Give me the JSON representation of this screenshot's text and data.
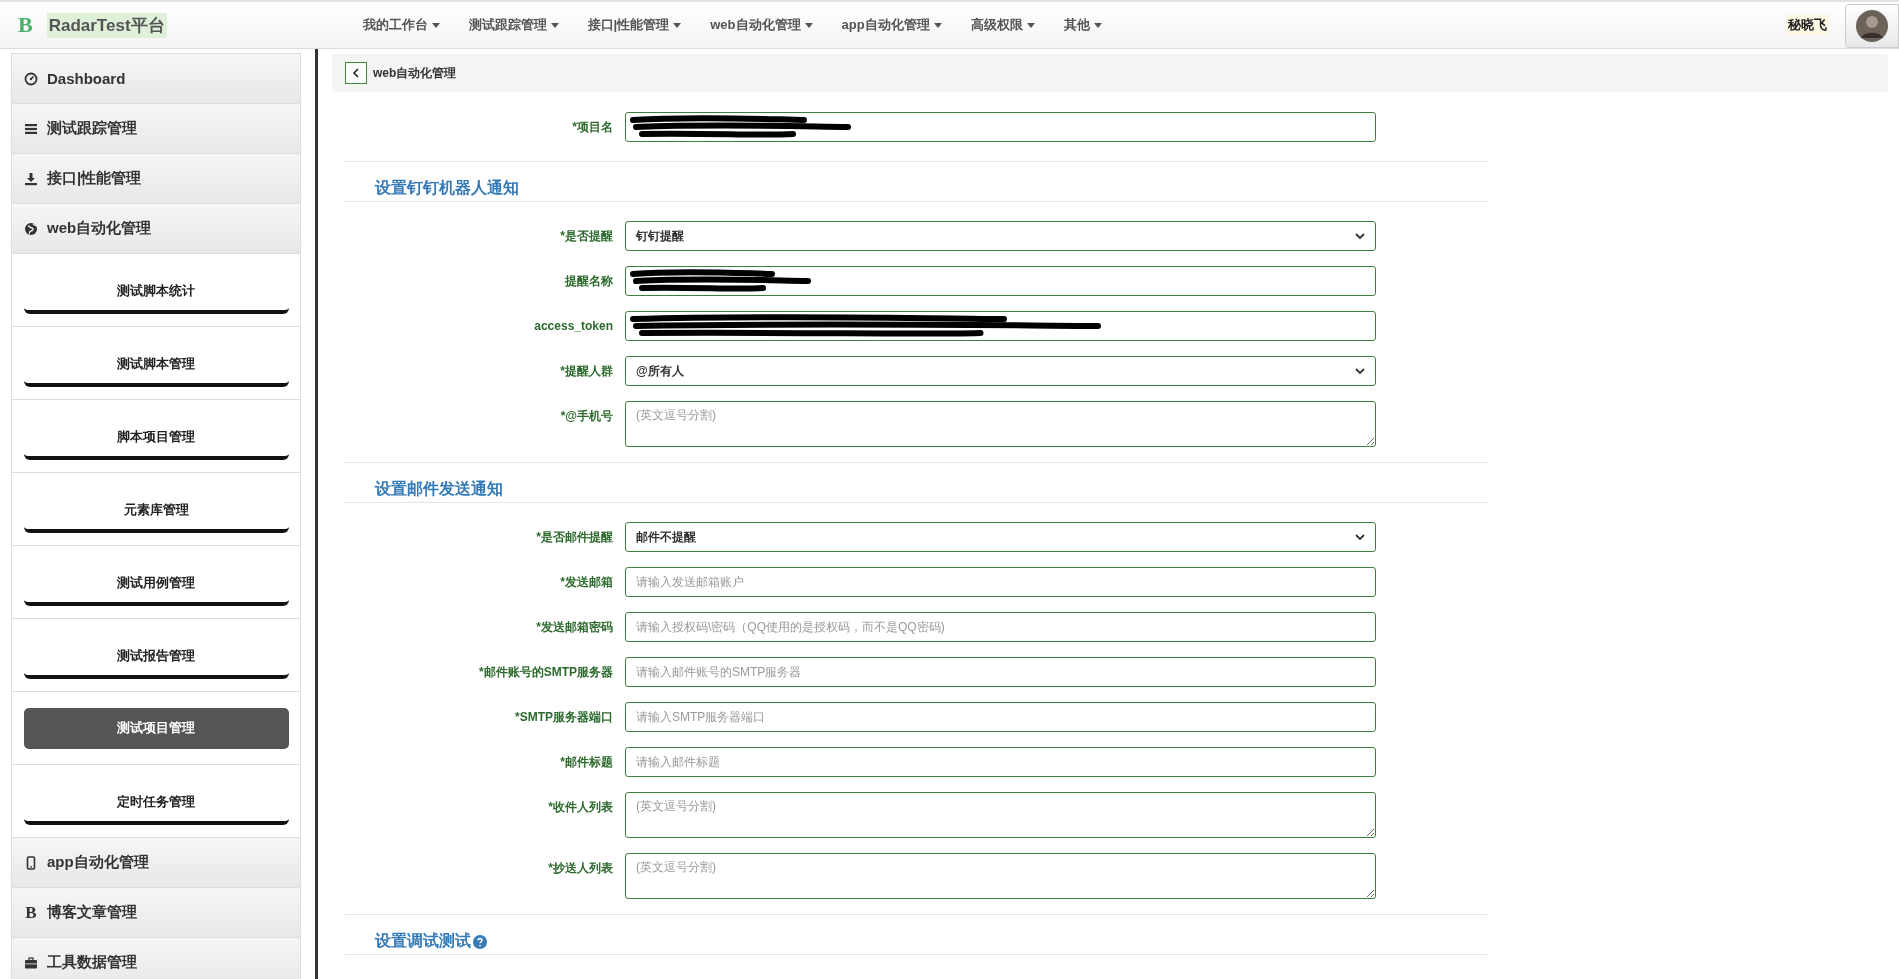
{
  "navbar": {
    "logo": "B",
    "brand": "RadarTest平台",
    "menus": [
      {
        "label": "我的工作台"
      },
      {
        "label": "测试跟踪管理"
      },
      {
        "label": "接口|性能管理"
      },
      {
        "label": "web自动化管理"
      },
      {
        "label": "app自动化管理"
      },
      {
        "label": "高级权限"
      },
      {
        "label": "其他"
      }
    ],
    "user": "秘晓飞"
  },
  "sidebar": {
    "items": [
      {
        "label": "Dashboard",
        "kind": "dashboard"
      },
      {
        "label": "测试跟踪管理",
        "kind": "list"
      },
      {
        "label": "接口|性能管理",
        "kind": "download"
      },
      {
        "label": "web自动化管理",
        "kind": "globe",
        "children": [
          {
            "label": "测试脚本统计",
            "selected": false
          },
          {
            "label": "测试脚本管理",
            "selected": false
          },
          {
            "label": "脚本项目管理",
            "selected": false
          },
          {
            "label": "元素库管理",
            "selected": false
          },
          {
            "label": "测试用例管理",
            "selected": false
          },
          {
            "label": "测试报告管理",
            "selected": false
          },
          {
            "label": "测试项目管理",
            "selected": true
          },
          {
            "label": "定时任务管理",
            "selected": false
          }
        ]
      },
      {
        "label": "app自动化管理",
        "kind": "mobile"
      },
      {
        "label": "博客文章管理",
        "kind": "letter",
        "icon_text": "B"
      },
      {
        "label": "工具数据管理",
        "kind": "briefcase"
      }
    ]
  },
  "breadcrumb": {
    "title": "web自动化管理"
  },
  "form": {
    "top_rows": [
      {
        "label": "*项目名",
        "kind": "input",
        "redacted": true
      }
    ],
    "sections": [
      {
        "title": "设置钉钉机器人通知",
        "rows": [
          {
            "label": "*是否提醒",
            "kind": "select",
            "value": "钉钉提醒"
          },
          {
            "label": "提醒名称",
            "kind": "input",
            "redacted": true
          },
          {
            "label": "access_token",
            "kind": "input",
            "redacted": true
          },
          {
            "label": "*提醒人群",
            "kind": "select",
            "value": "@所有人"
          },
          {
            "label": "*@手机号",
            "kind": "textarea",
            "placeholder": "(英文逗号分割)"
          }
        ]
      },
      {
        "title": "设置邮件发送通知",
        "rows": [
          {
            "label": "*是否邮件提醒",
            "kind": "select",
            "value": "邮件不提醒"
          },
          {
            "label": "*发送邮箱",
            "kind": "input",
            "placeholder": "请输入发送邮箱账户"
          },
          {
            "label": "*发送邮箱密码",
            "kind": "input",
            "placeholder": "请输入授权码\\密码（QQ使用的是授权码，而不是QQ密码)"
          },
          {
            "label": "*邮件账号的SMTP服务器",
            "kind": "input",
            "placeholder": "请输入邮件账号的SMTP服务器"
          },
          {
            "label": "*SMTP服务器端口",
            "kind": "input",
            "placeholder": "请输入SMTP服务器端口"
          },
          {
            "label": "*邮件标题",
            "kind": "input",
            "placeholder": "请输入邮件标题"
          },
          {
            "label": "*收件人列表",
            "kind": "textarea",
            "placeholder": "(英文逗号分割)"
          },
          {
            "label": "*抄送人列表",
            "kind": "textarea",
            "placeholder": "(英文逗号分割)"
          }
        ]
      },
      {
        "title": "设置调试测试",
        "help": true
      }
    ]
  }
}
